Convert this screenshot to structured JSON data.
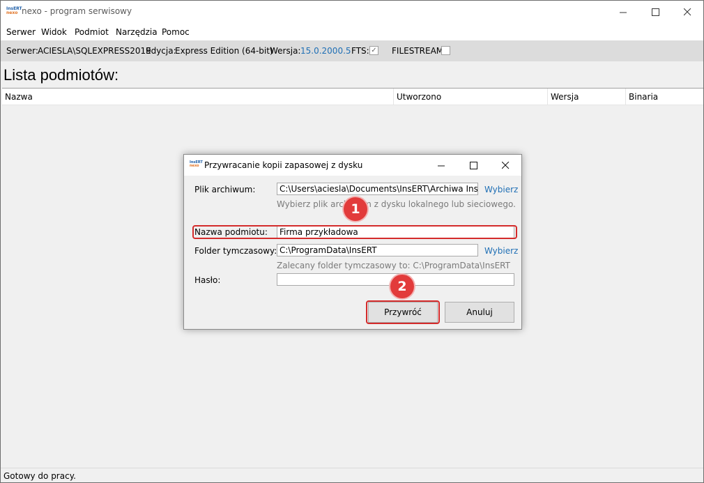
{
  "window": {
    "title": "nexo - program serwisowy",
    "logo_line1": "InsERT",
    "logo_line2": "nexo"
  },
  "menu": [
    "Serwer",
    "Widok",
    "Podmiot",
    "Narzędzia",
    "Pomoc"
  ],
  "infobar": {
    "server_label": "Serwer:",
    "server_value": "ACIESLA\\SQLEXPRESS2019",
    "edition_label": "Edycja:",
    "edition_value": "Express Edition (64-bit)",
    "version_label": "Wersja:",
    "version_value": "15.0.2000.5",
    "fts_label": "FTS:",
    "fts_checked": true,
    "filestream_label": "FILESTREAM:",
    "filestream_checked": false
  },
  "page_title": "Lista podmiotów:",
  "list_columns": [
    "Nazwa",
    "Utworzono",
    "Wersja",
    "Binaria"
  ],
  "status": "Gotowy do pracy.",
  "dialog": {
    "title": "Przywracanie kopii zapasowej z dysku",
    "archive_label": "Plik archiwum:",
    "archive_value": "C:\\Users\\aciesla\\Documents\\InsERT\\Archiwa InsERT ne",
    "archive_browse": "Wybierz",
    "archive_hint": "Wybierz plik archiwum z dysku lokalnego lub sieciowego.",
    "entity_label": "Nazwa podmiotu:",
    "entity_value": "Firma przykładowa",
    "temp_label": "Folder tymczasowy:",
    "temp_value": "C:\\ProgramData\\InsERT",
    "temp_browse": "Wybierz",
    "temp_hint": "Zalecany folder tymczasowy to: C:\\ProgramData\\InsERT",
    "password_label": "Hasło:",
    "password_value": "",
    "restore_button": "Przywróć",
    "cancel_button": "Anuluj"
  },
  "annotations": {
    "step1": "1",
    "step2": "2",
    "color": "#d42b2b"
  }
}
